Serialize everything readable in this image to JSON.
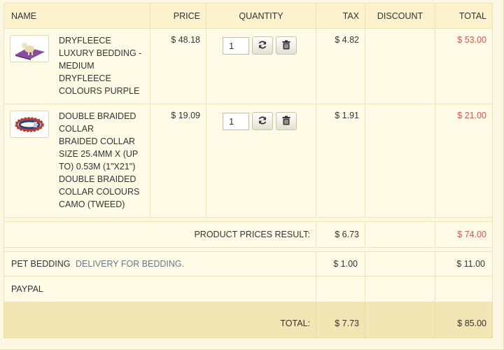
{
  "columns": {
    "name": "NAME",
    "price": "PRICE",
    "quantity": "QUANTITY",
    "tax": "TAX",
    "discount": "DISCOUNT",
    "total": "TOTAL"
  },
  "items": [
    {
      "name_lines": [
        "DRYFLEECE",
        "LUXURY BEDDING -",
        "MEDIUM",
        "DRYFLEECE",
        "COLOURS PURPLE"
      ],
      "price": "$ 48.18",
      "quantity": "1",
      "tax": "$ 4.82",
      "discount": "",
      "total": "$ 53.00",
      "image": "dog-bed-icon"
    },
    {
      "name_lines": [
        "DOUBLE BRAIDED",
        "COLLAR",
        "BRAIDED COLLAR",
        "SIZE 25.4MM X (UP",
        "TO) 0.53M (1\"X21\")",
        "DOUBLE BRAIDED",
        "COLLAR COLOURS",
        "CAMO (TWEED)"
      ],
      "price": "$ 19.09",
      "quantity": "1",
      "tax": "$ 1.91",
      "discount": "",
      "total": "$ 21.00",
      "image": "collar-icon"
    }
  ],
  "product_summary": {
    "label": "PRODUCT PRICES RESULT:",
    "tax": "$ 6.73",
    "total": "$ 74.00"
  },
  "shipping": {
    "name": "PET BEDDING",
    "description": "DELIVERY FOR BEDDING.",
    "tax": "$ 1.00",
    "total": "$ 11.00"
  },
  "payment": {
    "name": "PAYPAL"
  },
  "grand_total": {
    "label": "TOTAL:",
    "tax": "$ 7.73",
    "total": "$ 85.00"
  },
  "colors": {
    "total_red": "#d9534f",
    "footer_bg": "#f2e6b4"
  }
}
